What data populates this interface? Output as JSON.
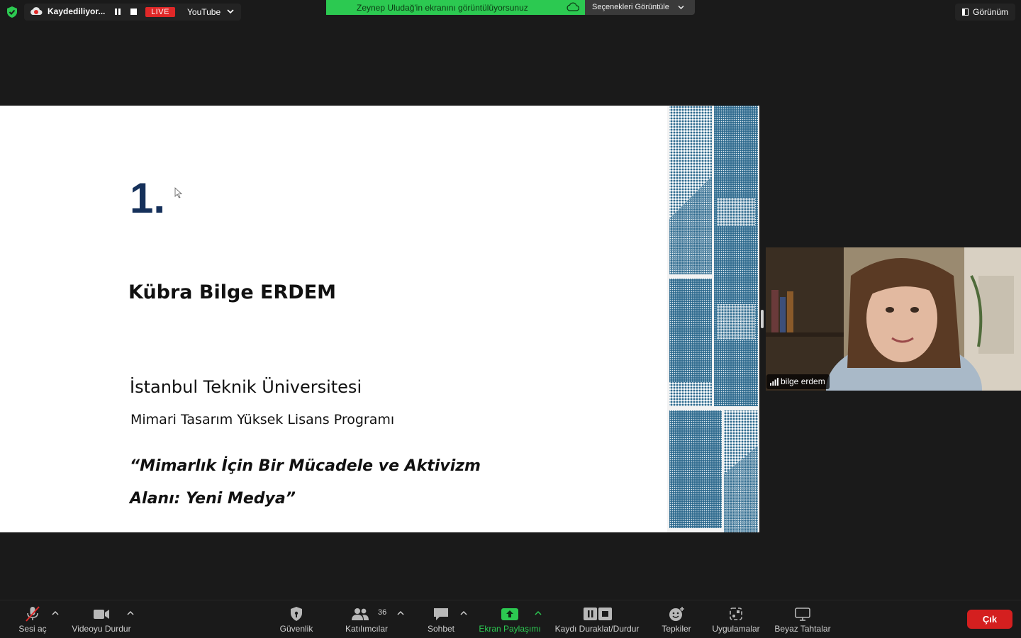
{
  "topbar": {
    "recording_status": "Kaydediliyor...",
    "live_badge": "LIVE",
    "stream_target": "YouTube",
    "share_banner": "Zeynep Uludağ'in ekranını görüntülüyorsunuz",
    "view_options": "Seçenekleri Görüntüle",
    "view_button": "Görünüm"
  },
  "slide": {
    "number": "1.",
    "author": "Kübra Bilge ERDEM",
    "university": "İstanbul Teknik Üniversitesi",
    "program": "Mimari Tasarım Yüksek Lisans Programı",
    "thesis_line1": "“Mimarlık İçin Bir Mücadele ve Aktivizm",
    "thesis_line2": "Alanı: Yeni Medya”"
  },
  "participant": {
    "name": "bilge erdem"
  },
  "toolbar": {
    "unmute": "Sesi aç",
    "stop_video": "Videoyu Durdur",
    "security": "Güvenlik",
    "participants": "Katılımcılar",
    "participants_count": "36",
    "chat": "Sohbet",
    "share_screen": "Ekran Paylaşımı",
    "pause_stop_recording": "Kaydı Duraklat/Durdur",
    "reactions": "Tepkiler",
    "apps": "Uygulamalar",
    "whiteboards": "Beyaz Tahtalar",
    "leave": "Çık"
  },
  "colors": {
    "share_banner": "#2cc951",
    "live_badge": "#e02828",
    "leave_button": "#d41f1f",
    "slide_accent": "#15305a",
    "share_active": "#2cc951"
  }
}
